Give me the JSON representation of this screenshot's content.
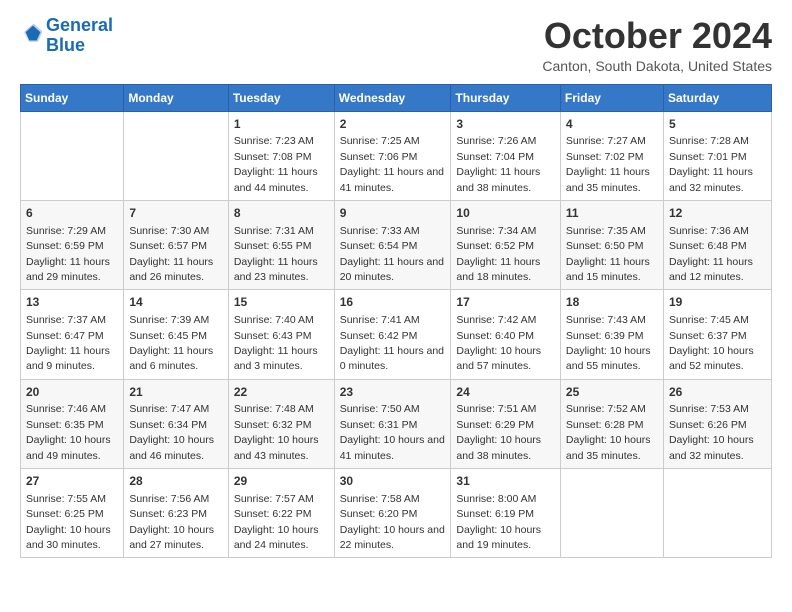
{
  "header": {
    "logo_line1": "General",
    "logo_line2": "Blue",
    "month": "October 2024",
    "location": "Canton, South Dakota, United States"
  },
  "weekdays": [
    "Sunday",
    "Monday",
    "Tuesday",
    "Wednesday",
    "Thursday",
    "Friday",
    "Saturday"
  ],
  "weeks": [
    [
      {
        "day": "",
        "sunrise": "",
        "sunset": "",
        "daylight": ""
      },
      {
        "day": "",
        "sunrise": "",
        "sunset": "",
        "daylight": ""
      },
      {
        "day": "1",
        "sunrise": "Sunrise: 7:23 AM",
        "sunset": "Sunset: 7:08 PM",
        "daylight": "Daylight: 11 hours and 44 minutes."
      },
      {
        "day": "2",
        "sunrise": "Sunrise: 7:25 AM",
        "sunset": "Sunset: 7:06 PM",
        "daylight": "Daylight: 11 hours and 41 minutes."
      },
      {
        "day": "3",
        "sunrise": "Sunrise: 7:26 AM",
        "sunset": "Sunset: 7:04 PM",
        "daylight": "Daylight: 11 hours and 38 minutes."
      },
      {
        "day": "4",
        "sunrise": "Sunrise: 7:27 AM",
        "sunset": "Sunset: 7:02 PM",
        "daylight": "Daylight: 11 hours and 35 minutes."
      },
      {
        "day": "5",
        "sunrise": "Sunrise: 7:28 AM",
        "sunset": "Sunset: 7:01 PM",
        "daylight": "Daylight: 11 hours and 32 minutes."
      }
    ],
    [
      {
        "day": "6",
        "sunrise": "Sunrise: 7:29 AM",
        "sunset": "Sunset: 6:59 PM",
        "daylight": "Daylight: 11 hours and 29 minutes."
      },
      {
        "day": "7",
        "sunrise": "Sunrise: 7:30 AM",
        "sunset": "Sunset: 6:57 PM",
        "daylight": "Daylight: 11 hours and 26 minutes."
      },
      {
        "day": "8",
        "sunrise": "Sunrise: 7:31 AM",
        "sunset": "Sunset: 6:55 PM",
        "daylight": "Daylight: 11 hours and 23 minutes."
      },
      {
        "day": "9",
        "sunrise": "Sunrise: 7:33 AM",
        "sunset": "Sunset: 6:54 PM",
        "daylight": "Daylight: 11 hours and 20 minutes."
      },
      {
        "day": "10",
        "sunrise": "Sunrise: 7:34 AM",
        "sunset": "Sunset: 6:52 PM",
        "daylight": "Daylight: 11 hours and 18 minutes."
      },
      {
        "day": "11",
        "sunrise": "Sunrise: 7:35 AM",
        "sunset": "Sunset: 6:50 PM",
        "daylight": "Daylight: 11 hours and 15 minutes."
      },
      {
        "day": "12",
        "sunrise": "Sunrise: 7:36 AM",
        "sunset": "Sunset: 6:48 PM",
        "daylight": "Daylight: 11 hours and 12 minutes."
      }
    ],
    [
      {
        "day": "13",
        "sunrise": "Sunrise: 7:37 AM",
        "sunset": "Sunset: 6:47 PM",
        "daylight": "Daylight: 11 hours and 9 minutes."
      },
      {
        "day": "14",
        "sunrise": "Sunrise: 7:39 AM",
        "sunset": "Sunset: 6:45 PM",
        "daylight": "Daylight: 11 hours and 6 minutes."
      },
      {
        "day": "15",
        "sunrise": "Sunrise: 7:40 AM",
        "sunset": "Sunset: 6:43 PM",
        "daylight": "Daylight: 11 hours and 3 minutes."
      },
      {
        "day": "16",
        "sunrise": "Sunrise: 7:41 AM",
        "sunset": "Sunset: 6:42 PM",
        "daylight": "Daylight: 11 hours and 0 minutes."
      },
      {
        "day": "17",
        "sunrise": "Sunrise: 7:42 AM",
        "sunset": "Sunset: 6:40 PM",
        "daylight": "Daylight: 10 hours and 57 minutes."
      },
      {
        "day": "18",
        "sunrise": "Sunrise: 7:43 AM",
        "sunset": "Sunset: 6:39 PM",
        "daylight": "Daylight: 10 hours and 55 minutes."
      },
      {
        "day": "19",
        "sunrise": "Sunrise: 7:45 AM",
        "sunset": "Sunset: 6:37 PM",
        "daylight": "Daylight: 10 hours and 52 minutes."
      }
    ],
    [
      {
        "day": "20",
        "sunrise": "Sunrise: 7:46 AM",
        "sunset": "Sunset: 6:35 PM",
        "daylight": "Daylight: 10 hours and 49 minutes."
      },
      {
        "day": "21",
        "sunrise": "Sunrise: 7:47 AM",
        "sunset": "Sunset: 6:34 PM",
        "daylight": "Daylight: 10 hours and 46 minutes."
      },
      {
        "day": "22",
        "sunrise": "Sunrise: 7:48 AM",
        "sunset": "Sunset: 6:32 PM",
        "daylight": "Daylight: 10 hours and 43 minutes."
      },
      {
        "day": "23",
        "sunrise": "Sunrise: 7:50 AM",
        "sunset": "Sunset: 6:31 PM",
        "daylight": "Daylight: 10 hours and 41 minutes."
      },
      {
        "day": "24",
        "sunrise": "Sunrise: 7:51 AM",
        "sunset": "Sunset: 6:29 PM",
        "daylight": "Daylight: 10 hours and 38 minutes."
      },
      {
        "day": "25",
        "sunrise": "Sunrise: 7:52 AM",
        "sunset": "Sunset: 6:28 PM",
        "daylight": "Daylight: 10 hours and 35 minutes."
      },
      {
        "day": "26",
        "sunrise": "Sunrise: 7:53 AM",
        "sunset": "Sunset: 6:26 PM",
        "daylight": "Daylight: 10 hours and 32 minutes."
      }
    ],
    [
      {
        "day": "27",
        "sunrise": "Sunrise: 7:55 AM",
        "sunset": "Sunset: 6:25 PM",
        "daylight": "Daylight: 10 hours and 30 minutes."
      },
      {
        "day": "28",
        "sunrise": "Sunrise: 7:56 AM",
        "sunset": "Sunset: 6:23 PM",
        "daylight": "Daylight: 10 hours and 27 minutes."
      },
      {
        "day": "29",
        "sunrise": "Sunrise: 7:57 AM",
        "sunset": "Sunset: 6:22 PM",
        "daylight": "Daylight: 10 hours and 24 minutes."
      },
      {
        "day": "30",
        "sunrise": "Sunrise: 7:58 AM",
        "sunset": "Sunset: 6:20 PM",
        "daylight": "Daylight: 10 hours and 22 minutes."
      },
      {
        "day": "31",
        "sunrise": "Sunrise: 8:00 AM",
        "sunset": "Sunset: 6:19 PM",
        "daylight": "Daylight: 10 hours and 19 minutes."
      },
      {
        "day": "",
        "sunrise": "",
        "sunset": "",
        "daylight": ""
      },
      {
        "day": "",
        "sunrise": "",
        "sunset": "",
        "daylight": ""
      }
    ]
  ]
}
